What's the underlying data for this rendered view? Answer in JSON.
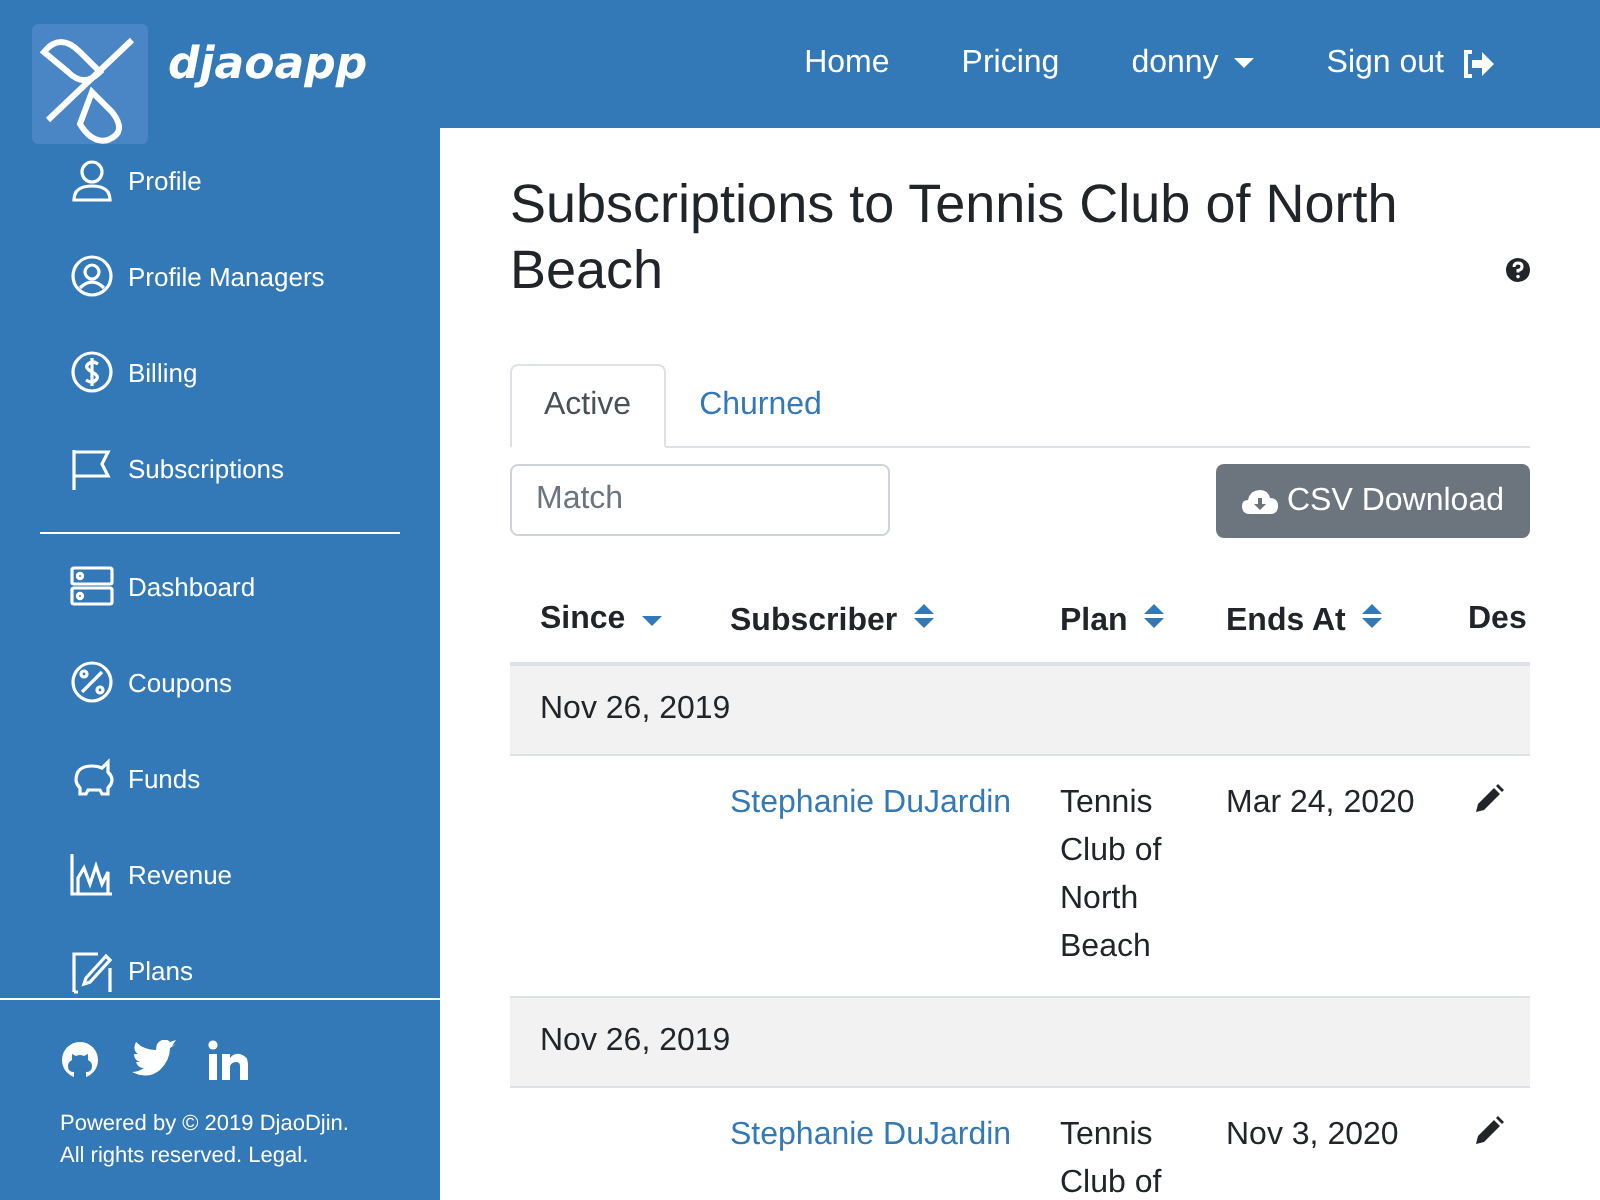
{
  "brand": {
    "name": "djaoapp"
  },
  "nav": [
    {
      "label": "Home",
      "kind": "link"
    },
    {
      "label": "Pricing",
      "kind": "link"
    },
    {
      "label": "donny",
      "kind": "dropdown"
    },
    {
      "label": "Sign out",
      "kind": "signout"
    }
  ],
  "sidebar": {
    "sections": [
      {
        "items": [
          {
            "label": "Profile"
          },
          {
            "label": "Profile Managers"
          },
          {
            "label": "Billing"
          },
          {
            "label": "Subscriptions"
          }
        ]
      },
      {
        "items": [
          {
            "label": "Dashboard"
          },
          {
            "label": "Coupons"
          },
          {
            "label": "Funds"
          },
          {
            "label": "Revenue"
          },
          {
            "label": "Plans"
          }
        ]
      }
    ],
    "footer": {
      "line_1": "Powered by © 2019 DjaoDjin.",
      "line_2": "All rights reserved.",
      "link": "Legal."
    }
  },
  "title": "Subscriptions to Tennis Club of North Beach",
  "tabs": [
    {
      "label": "Active",
      "selected": true
    },
    {
      "label": "Churned",
      "selected": false
    }
  ],
  "search": {
    "placeholder": "Match"
  },
  "download_button": "CSV Download",
  "table": {
    "columns": [
      {
        "label": "Since",
        "sorted": true
      },
      {
        "label": "Subscriber",
        "sorted": false
      },
      {
        "label": "Plan",
        "sorted": false
      },
      {
        "label": "Ends At",
        "sorted": false
      },
      {
        "label": "Des"
      }
    ],
    "groups": [
      {
        "date": "Nov 26, 2019",
        "rows": [
          {
            "subscriber": "Stephanie DuJardin",
            "plan": "Tennis Club of North Beach",
            "ends_at": "Mar 24, 2020"
          }
        ]
      },
      {
        "date": "Nov 26, 2019",
        "rows": [
          {
            "subscriber": "Stephanie DuJardin",
            "plan": "Tennis Club of",
            "ends_at": "Nov 3, 2020"
          }
        ]
      }
    ]
  }
}
